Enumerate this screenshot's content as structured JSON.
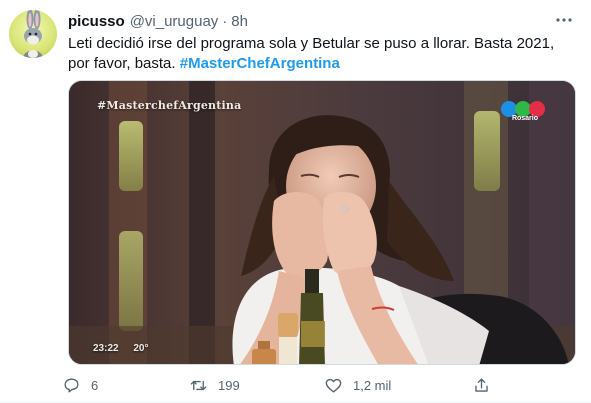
{
  "tweet": {
    "author_name": "picusso",
    "handle": "@vi_uruguay",
    "separator": "·",
    "time": "8h",
    "text_main": "Leti decidió irse del programa sola y Betular se puso a llorar. Basta 2021, por favor, basta.",
    "hashtag": "#MasterChefArgentina"
  },
  "media": {
    "watermark": "#MasterchefArgentina",
    "channel_label": "Rosario",
    "clock": "23:22",
    "temperature": "20°",
    "logo_colors": [
      "#1d8fe6",
      "#2fb84a",
      "#e42d47"
    ]
  },
  "actions": {
    "reply_count": "6",
    "retweet_count": "199",
    "like_count": "1,2 mil"
  },
  "colors": {
    "accent": "#1d9bf0",
    "secondary_text": "#536471"
  }
}
